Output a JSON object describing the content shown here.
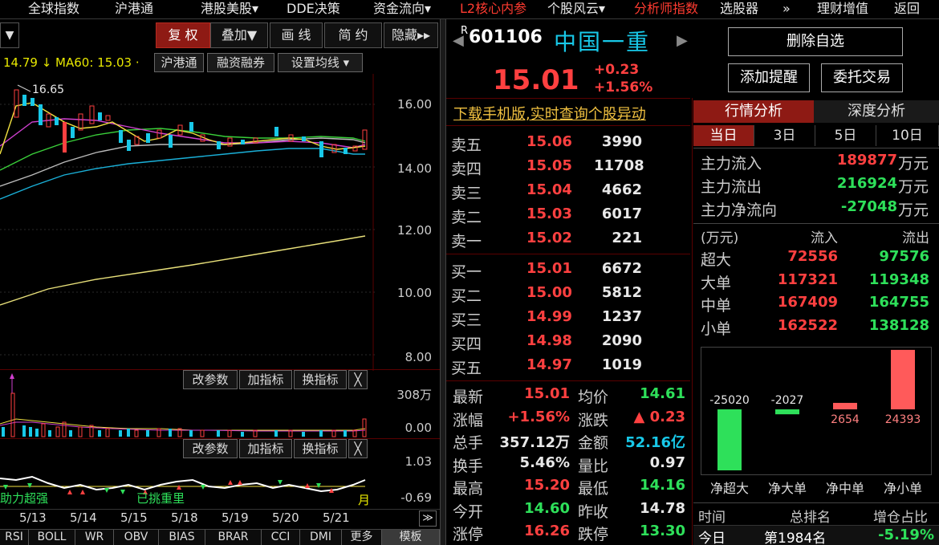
{
  "menu": {
    "items": [
      {
        "label": "全球指数",
        "red": false
      },
      {
        "label": "沪港通",
        "red": false
      },
      {
        "label": "港股美股▾",
        "red": false
      },
      {
        "label": "DDE决策",
        "red": false
      },
      {
        "label": "资金流向▾",
        "red": false
      },
      {
        "label": "L2核心内参",
        "red": true
      },
      {
        "label": "个股风云▾",
        "red": false
      },
      {
        "label": "分析师指数",
        "red": true
      },
      {
        "label": "选股器",
        "red": false
      },
      {
        "label": "»",
        "red": false
      },
      {
        "label": "理财增值",
        "red": false
      },
      {
        "label": "返回",
        "red": false
      }
    ]
  },
  "chart_toolbar": {
    "dropdown_glyph": "▼",
    "buttons": [
      "复 权",
      "叠加▼",
      "画 线",
      "简 约",
      "隐藏▸▸"
    ],
    "active_index": 0
  },
  "ma_bar": {
    "ma_text": "14.79 ↓ MA60: 15.03 ·",
    "tags": [
      "沪港通",
      "融资融券",
      "设置均线 ▾"
    ]
  },
  "price_chart": {
    "y_ticks": [
      "16.00",
      "14.00",
      "12.00",
      "10.00",
      "8.00"
    ],
    "high_label": "16.65"
  },
  "volume_panel": {
    "buttons": [
      "改参数",
      "加指标",
      "换指标",
      "╳"
    ],
    "y_ticks": [
      "308万",
      "0.00"
    ]
  },
  "indicator_panel": {
    "buttons": [
      "改参数",
      "加指标",
      "换指标",
      "╳"
    ],
    "y_ticks": [
      "1.03",
      "-0.69"
    ],
    "overlay_left": "助力超强",
    "overlay_mid": "已挑重里",
    "overlay_right": "月"
  },
  "dates": [
    "5/13",
    "5/14",
    "5/15",
    "5/18",
    "5/19",
    "5/20",
    "5/21"
  ],
  "scroll_glyph": "≫",
  "bottom_tabs": [
    "RSI",
    "BOLL",
    "WR",
    "OBV",
    "BIAS",
    "BRAR",
    "CCI",
    "DMI",
    "更多",
    "模板"
  ],
  "stock": {
    "code_sup": "R",
    "code": "601106",
    "name": "中国一重",
    "price": "15.01",
    "change": "+0.23",
    "change_pct": "+1.56%",
    "nav_left": "◀",
    "nav_right": "▶"
  },
  "actions": {
    "remove": "删除自选",
    "alert": "添加提醒",
    "trade": "委托交易"
  },
  "promo": "下载手机版,实时查询个股异动",
  "order_book": {
    "asks": [
      {
        "label": "卖五",
        "price": "15.06",
        "vol": "3990"
      },
      {
        "label": "卖四",
        "price": "15.05",
        "vol": "11708"
      },
      {
        "label": "卖三",
        "price": "15.04",
        "vol": "4662"
      },
      {
        "label": "卖二",
        "price": "15.03",
        "vol": "6017"
      },
      {
        "label": "卖一",
        "price": "15.02",
        "vol": "221"
      }
    ],
    "bids": [
      {
        "label": "买一",
        "price": "15.01",
        "vol": "6672"
      },
      {
        "label": "买二",
        "price": "15.00",
        "vol": "5812"
      },
      {
        "label": "买三",
        "price": "14.99",
        "vol": "1237"
      },
      {
        "label": "买四",
        "price": "14.98",
        "vol": "2090"
      },
      {
        "label": "买五",
        "price": "14.97",
        "vol": "1019"
      }
    ]
  },
  "stats": [
    {
      "l1": "最新",
      "v1": "15.01",
      "c1": "red",
      "l2": "均价",
      "v2": "14.61",
      "c2": "green"
    },
    {
      "l1": "涨幅",
      "v1": "+1.56%",
      "c1": "red",
      "l2": "涨跌",
      "v2": "▲ 0.23",
      "c2": "red"
    },
    {
      "l1": "总手",
      "v1": "357.12万",
      "c1": "white",
      "l2": "金额",
      "v2": "52.16亿",
      "c2": "cyan"
    },
    {
      "l1": "换手",
      "v1": "5.46%",
      "c1": "white",
      "l2": "量比",
      "v2": "0.97",
      "c2": "white"
    },
    {
      "l1": "最高",
      "v1": "15.20",
      "c1": "red",
      "l2": "最低",
      "v2": "14.16",
      "c2": "green"
    },
    {
      "l1": "今开",
      "v1": "14.60",
      "c1": "green",
      "l2": "昨收",
      "v2": "14.78",
      "c2": "white"
    },
    {
      "l1": "涨停",
      "v1": "16.26",
      "c1": "red",
      "l2": "跌停",
      "v2": "13.30",
      "c2": "green"
    }
  ],
  "analysis": {
    "tabs": [
      "行情分析",
      "深度分析"
    ],
    "day_tabs": [
      "当日",
      "3日",
      "5日",
      "10日"
    ],
    "flows": [
      {
        "label": "主力流入",
        "value": "189877",
        "color": "red",
        "unit": "万元"
      },
      {
        "label": "主力流出",
        "value": "216924",
        "color": "green",
        "unit": "万元"
      },
      {
        "label": "主力净流向",
        "value": "-27048",
        "color": "green",
        "unit": "万元"
      }
    ],
    "table_header": [
      "(万元)",
      "流入",
      "流出"
    ],
    "table": [
      {
        "label": "超大",
        "in": "72556",
        "out": "97576"
      },
      {
        "label": "大单",
        "in": "117321",
        "out": "119348"
      },
      {
        "label": "中单",
        "in": "167409",
        "out": "164755"
      },
      {
        "label": "小单",
        "in": "162522",
        "out": "138128"
      }
    ],
    "footer": {
      "c1": "时间",
      "c2": "总排名",
      "c3": "增仓占比",
      "d1": "今日",
      "d2": "第1984名",
      "d3": "-5.19%"
    }
  },
  "chart_data": {
    "type": "bar",
    "categories": [
      "净超大",
      "净大单",
      "净中单",
      "净小单"
    ],
    "values": [
      -25020,
      -2027,
      2654,
      24393
    ],
    "value_labels": [
      "-25020",
      "-2027",
      "2654",
      "24393"
    ],
    "colors": {
      "positive": "#ff5a5a",
      "negative": "#2ee05a"
    }
  },
  "colors": {
    "up": "#ff4040",
    "down": "#2ee05a",
    "accent": "#18c8e8"
  }
}
